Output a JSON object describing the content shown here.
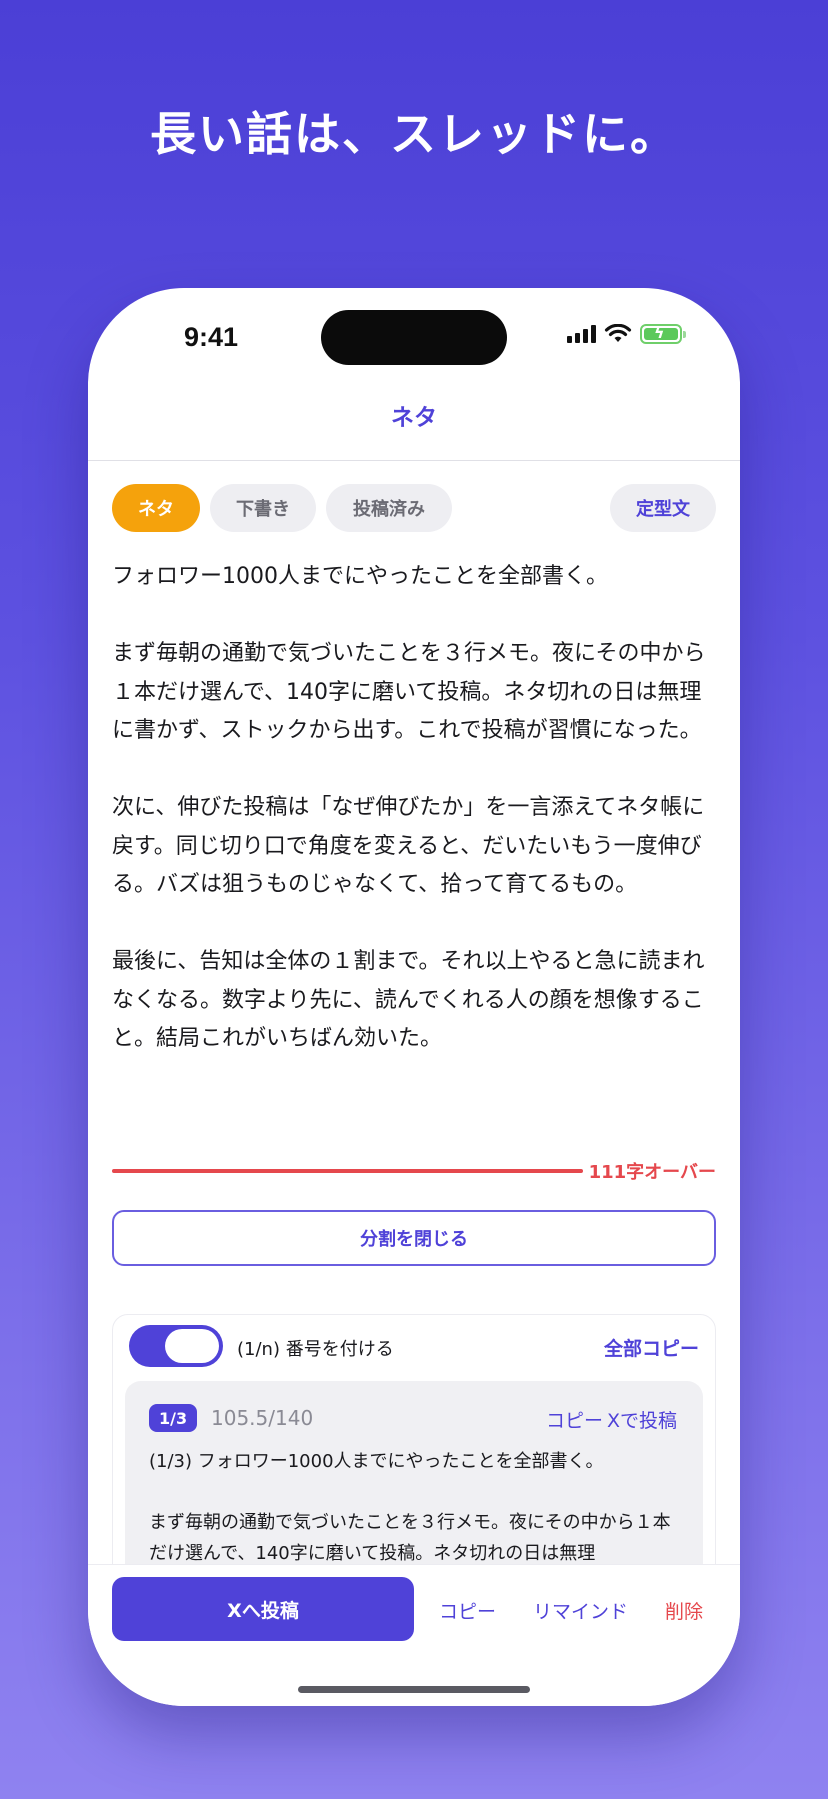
{
  "headline": "長い話は、スレッドに。",
  "status": {
    "time": "9:41"
  },
  "nav": {
    "title": "ネタ"
  },
  "tabs": {
    "neta": "ネタ",
    "draft": "下書き",
    "posted": "投稿済み",
    "template": "定型文"
  },
  "editor": {
    "text": "フォロワー1000人までにやったことを全部書く。\n\nまず毎朝の通勤で気づいたことを３行メモ。夜にその中から１本だけ選んで、140字に磨いて投稿。ネタ切れの日は無理に書かず、ストックから出す。これで投稿が習慣になった。\n\n次に、伸びた投稿は「なぜ伸びたか」を一言添えてネタ帳に戻す。同じ切り口で角度を変えると、だいたいもう一度伸びる。バズは狙うものじゃなくて、拾って育てるもの。\n\n最後に、告知は全体の１割まで。それ以上やると急に読まれなくなる。数字より先に、読んでくれる人の顔を想像すること。結局これがいちばん効いた。",
    "over_label": "111字オーバー",
    "split_close": "分割を閉じる",
    "over_ratio": 0.78
  },
  "split": {
    "toggle_label": "(1/n) 番号を付ける",
    "toggle_on": true,
    "copy_all": "全部コピー",
    "parts": [
      {
        "badge": "1/3",
        "count": "105.5/140",
        "copy": "コピー",
        "post": "Xで投稿",
        "text": "(1/3) フォロワー1000人までにやったことを全部書く。\n\nまず毎朝の通勤で気づいたことを３行メモ。夜にその中から１本だけ選んで、140字に磨いて投稿。ネタ切れの日は無理"
      }
    ]
  },
  "bottom": {
    "post_x": "Xへ投稿",
    "copy": "コピー",
    "remind": "リマインド",
    "delete": "削除"
  },
  "colors": {
    "accent": "#4f42d8",
    "tab_active": "#f5a20c",
    "danger": "#e5484d"
  },
  "icons": {
    "signal": "cellular-signal-icon",
    "wifi": "wifi-icon",
    "battery": "battery-charging-icon"
  }
}
